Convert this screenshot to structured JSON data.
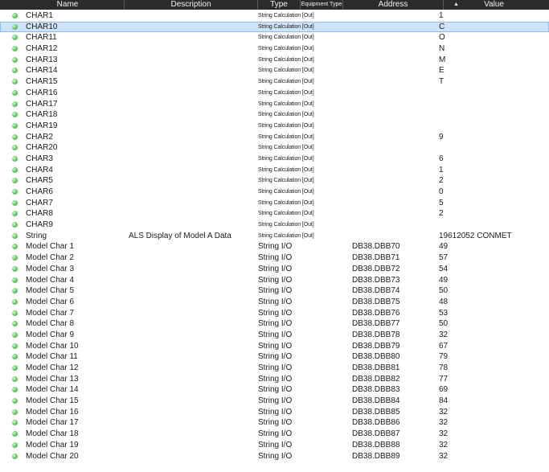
{
  "columns": {
    "name": "Name",
    "description": "Description",
    "type": "Type",
    "equipment_type": "Equipment Type",
    "address": "Address",
    "value": "Value"
  },
  "icons": {
    "status": "status-ok-icon",
    "sort": "sort-ascending-icon"
  },
  "colors": {
    "header_bg": "#2b2b2b",
    "status_ok": "#4cbb4c",
    "selected_row": "#cfe4f8"
  },
  "rows": [
    {
      "name": "CHAR1",
      "description": "",
      "type": "String Calculation [Out]",
      "address": "",
      "value": "1"
    },
    {
      "name": "CHAR10",
      "description": "",
      "type": "String Calculation [Out]",
      "address": "",
      "value": "C",
      "selected": true
    },
    {
      "name": "CHAR11",
      "description": "",
      "type": "String Calculation [Out]",
      "address": "",
      "value": "O"
    },
    {
      "name": "CHAR12",
      "description": "",
      "type": "String Calculation [Out]",
      "address": "",
      "value": "N"
    },
    {
      "name": "CHAR13",
      "description": "",
      "type": "String Calculation [Out]",
      "address": "",
      "value": "M"
    },
    {
      "name": "CHAR14",
      "description": "",
      "type": "String Calculation [Out]",
      "address": "",
      "value": "E"
    },
    {
      "name": "CHAR15",
      "description": "",
      "type": "String Calculation [Out]",
      "address": "",
      "value": "T"
    },
    {
      "name": "CHAR16",
      "description": "",
      "type": "String Calculation [Out]",
      "address": "",
      "value": ""
    },
    {
      "name": "CHAR17",
      "description": "",
      "type": "String Calculation [Out]",
      "address": "",
      "value": ""
    },
    {
      "name": "CHAR18",
      "description": "",
      "type": "String Calculation [Out]",
      "address": "",
      "value": ""
    },
    {
      "name": "CHAR19",
      "description": "",
      "type": "String Calculation [Out]",
      "address": "",
      "value": ""
    },
    {
      "name": "CHAR2",
      "description": "",
      "type": "String Calculation [Out]",
      "address": "",
      "value": "9"
    },
    {
      "name": "CHAR20",
      "description": "",
      "type": "String Calculation [Out]",
      "address": "",
      "value": ""
    },
    {
      "name": "CHAR3",
      "description": "",
      "type": "String Calculation [Out]",
      "address": "",
      "value": "6"
    },
    {
      "name": "CHAR4",
      "description": "",
      "type": "String Calculation [Out]",
      "address": "",
      "value": "1"
    },
    {
      "name": "CHAR5",
      "description": "",
      "type": "String Calculation [Out]",
      "address": "",
      "value": "2"
    },
    {
      "name": "CHAR6",
      "description": "",
      "type": "String Calculation [Out]",
      "address": "",
      "value": "0"
    },
    {
      "name": "CHAR7",
      "description": "",
      "type": "String Calculation [Out]",
      "address": "",
      "value": "5"
    },
    {
      "name": "CHAR8",
      "description": "",
      "type": "String Calculation [Out]",
      "address": "",
      "value": "2"
    },
    {
      "name": "CHAR9",
      "description": "",
      "type": "String Calculation [Out]",
      "address": "",
      "value": ""
    },
    {
      "name": "String",
      "description": "ALS Display of Model A Data",
      "type": "String Calculation [Out]",
      "address": "",
      "value": "19612052 CONMET"
    },
    {
      "name": "Model Char 1",
      "description": "",
      "type": "String I/O",
      "address": "DB38.DBB70",
      "value": "49"
    },
    {
      "name": "Model Char 2",
      "description": "",
      "type": "String I/O",
      "address": "DB38.DBB71",
      "value": "57"
    },
    {
      "name": "Model Char 3",
      "description": "",
      "type": "String I/O",
      "address": "DB38.DBB72",
      "value": "54"
    },
    {
      "name": "Model Char 4",
      "description": "",
      "type": "String I/O",
      "address": "DB38.DBB73",
      "value": "49"
    },
    {
      "name": "Model Char 5",
      "description": "",
      "type": "String I/O",
      "address": "DB38.DBB74",
      "value": "50"
    },
    {
      "name": "Model Char 6",
      "description": "",
      "type": "String I/O",
      "address": "DB38.DBB75",
      "value": "48"
    },
    {
      "name": "Model Char 7",
      "description": "",
      "type": "String I/O",
      "address": "DB38.DBB76",
      "value": "53"
    },
    {
      "name": "Model Char 8",
      "description": "",
      "type": "String I/O",
      "address": "DB38.DBB77",
      "value": "50"
    },
    {
      "name": "Model Char 9",
      "description": "",
      "type": "String I/O",
      "address": "DB38.DBB78",
      "value": "32"
    },
    {
      "name": "Model Char 10",
      "description": "",
      "type": "String I/O",
      "address": "DB38.DBB79",
      "value": "67"
    },
    {
      "name": "Model Char 11",
      "description": "",
      "type": "String I/O",
      "address": "DB38.DBB80",
      "value": "79"
    },
    {
      "name": "Model Char 12",
      "description": "",
      "type": "String I/O",
      "address": "DB38.DBB81",
      "value": "78"
    },
    {
      "name": "Model Char 13",
      "description": "",
      "type": "String I/O",
      "address": "DB38.DBB82",
      "value": "77"
    },
    {
      "name": "Model Char 14",
      "description": "",
      "type": "String I/O",
      "address": "DB38.DBB83",
      "value": "69"
    },
    {
      "name": "Model Char 15",
      "description": "",
      "type": "String I/O",
      "address": "DB38.DBB84",
      "value": "84"
    },
    {
      "name": "Model Char 16",
      "description": "",
      "type": "String I/O",
      "address": "DB38.DBB85",
      "value": "32"
    },
    {
      "name": "Model Char 17",
      "description": "",
      "type": "String I/O",
      "address": "DB38.DBB86",
      "value": "32"
    },
    {
      "name": "Model Char 18",
      "description": "",
      "type": "String I/O",
      "address": "DB38.DBB87",
      "value": "32"
    },
    {
      "name": "Model Char 19",
      "description": "",
      "type": "String I/O",
      "address": "DB38.DBB88",
      "value": "32"
    },
    {
      "name": "Model Char 20",
      "description": "",
      "type": "String I/O",
      "address": "DB38.DBB89",
      "value": "32"
    }
  ]
}
